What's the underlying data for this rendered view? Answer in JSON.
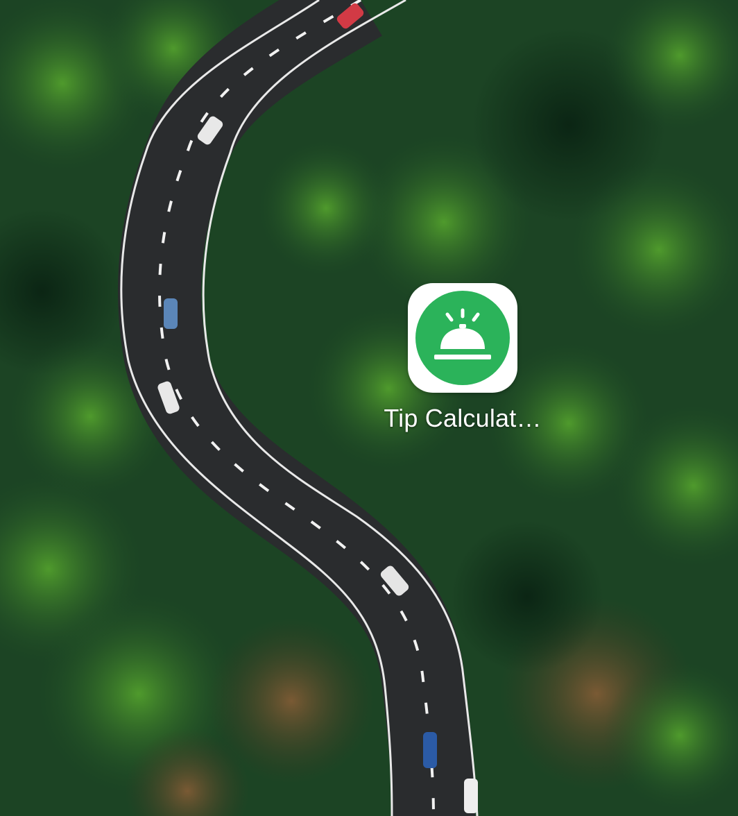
{
  "homescreen": {
    "wallpaper": {
      "subject": "winding-road-through-forest"
    },
    "apps": [
      {
        "label": "Tip Calculat…",
        "icon": "service-bell-icon",
        "icon_color": "#2bb35a",
        "icon_bg": "#ffffff"
      }
    ]
  },
  "colors": {
    "forest": "#1d4a26",
    "road": "#2a2c2e",
    "lane": "#f2f2f2"
  }
}
